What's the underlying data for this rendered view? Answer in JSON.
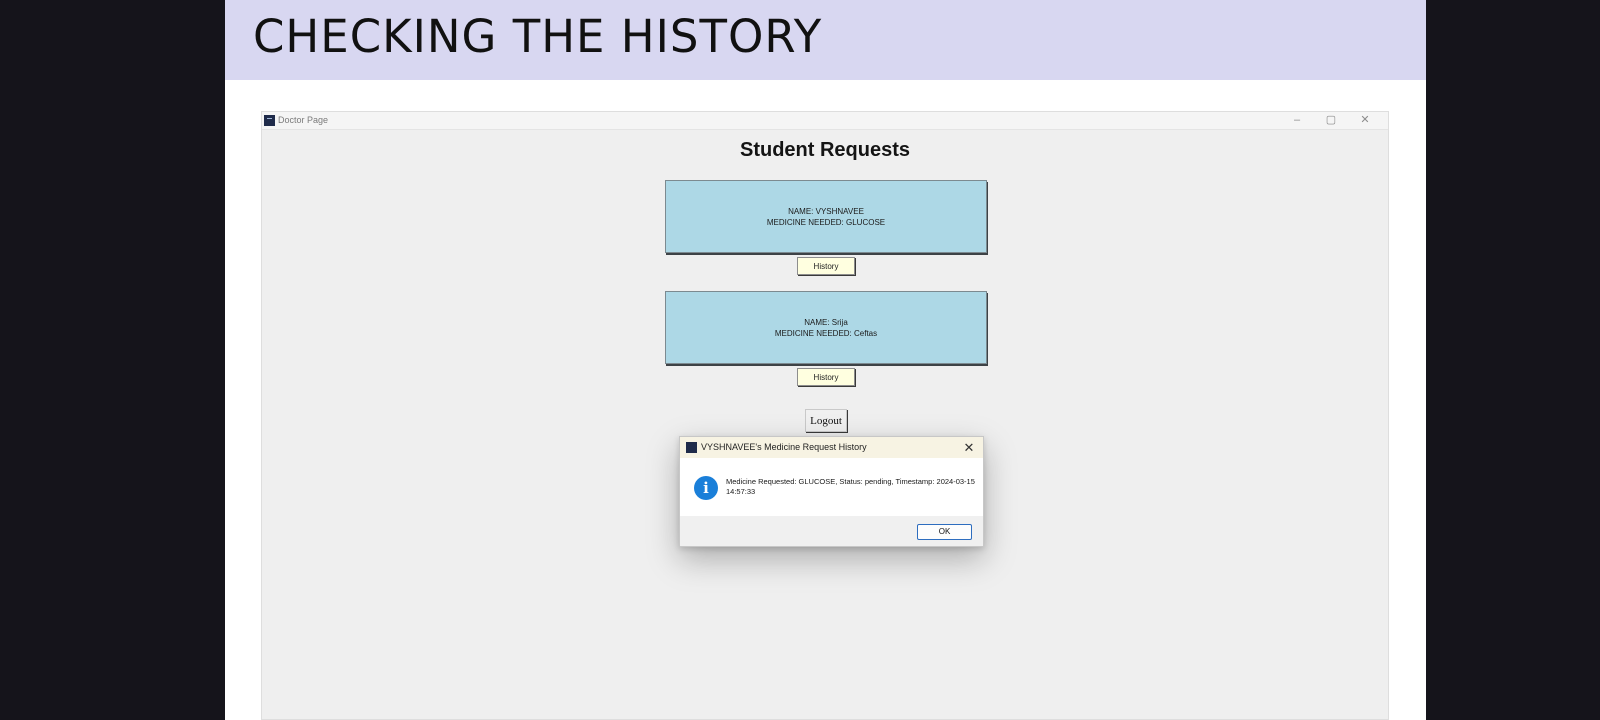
{
  "slide": {
    "title": "CHECKING THE HISTORY"
  },
  "window": {
    "title": "Doctor Page",
    "controls": {
      "minimize": "–",
      "maximize": "▢",
      "close": "✕"
    }
  },
  "page": {
    "heading": "Student Requests"
  },
  "requests": [
    {
      "name_line": "NAME: VYSHNAVEE",
      "medicine_line": "MEDICINE NEEDED: GLUCOSE",
      "history_label": "History"
    },
    {
      "name_line": "NAME: Srija",
      "medicine_line": "MEDICINE NEEDED: Ceftas",
      "history_label": "History"
    }
  ],
  "logout_label": "Logout",
  "dialog": {
    "title": "VYSHNAVEE's Medicine Request History",
    "close_glyph": "✕",
    "icon_glyph": "i",
    "message": "Medicine Requested: GLUCOSE, Status: pending, Timestamp: 2024-03-15 14:57:33",
    "ok_label": "OK"
  },
  "colors": {
    "header_band": "#d8d7f1",
    "card_bg": "#add8e6",
    "history_button_bg": "#ffffe0",
    "info_icon": "#1a7fd9"
  }
}
